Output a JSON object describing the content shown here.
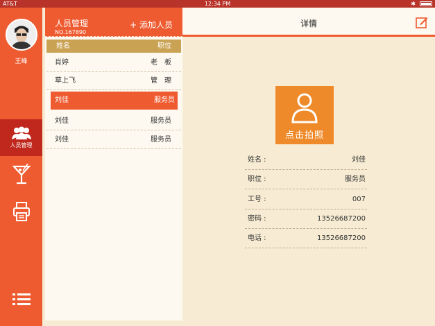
{
  "statusbar": {
    "carrier": "AT&T",
    "time": "12:34 PM"
  },
  "user": {
    "name": "王峰"
  },
  "nav": {
    "users_label": "人员管理"
  },
  "list": {
    "title": "人员管理",
    "number": "NO.167890",
    "add_label": "+ 添加人员",
    "col_name": "姓名",
    "col_role": "职位",
    "rows": [
      {
        "name": "肖婷",
        "role": "老　板"
      },
      {
        "name": "草上飞",
        "role": "管　理"
      },
      {
        "name": "刘佳",
        "role": "服务员"
      },
      {
        "name": "刘佳",
        "role": "服务员"
      },
      {
        "name": "刘佳",
        "role": "服务员"
      }
    ]
  },
  "detail": {
    "title": "详情",
    "photo_label": "点击拍照",
    "fields": [
      {
        "key": "姓名 :",
        "value": "刘佳"
      },
      {
        "key": "职位 :",
        "value": "服务员"
      },
      {
        "key": "工号 :",
        "value": "007"
      },
      {
        "key": "密码 :",
        "value": "13526687200"
      },
      {
        "key": "电话 :",
        "value": "13526687200"
      }
    ]
  },
  "colors": {
    "accent": "#ef5b30",
    "nav_active": "#c0281e",
    "table_head": "#c9a253",
    "photo_bg": "#ef8a2a",
    "background": "#f7ecd3"
  },
  "icons": {
    "users": "users-icon",
    "bar": "cocktail-icon",
    "printer": "printer-icon",
    "menu": "menu-icon",
    "edit": "edit-icon",
    "camera": "person-silhouette-icon"
  }
}
